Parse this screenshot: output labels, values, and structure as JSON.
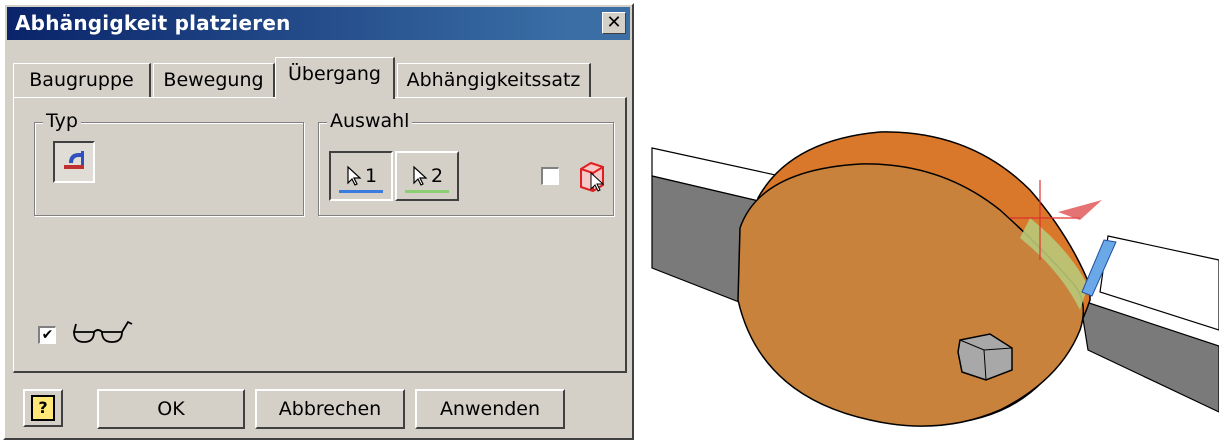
{
  "dialog": {
    "title": "Abhängigkeit platzieren",
    "close_glyph": "✕",
    "tabs": [
      {
        "label": "Baugruppe",
        "active": false
      },
      {
        "label": "Bewegung",
        "active": false
      },
      {
        "label": "Übergang",
        "active": true
      },
      {
        "label": "Abhängigkeitssatz",
        "active": false
      }
    ],
    "typ_group": {
      "label": "Typ",
      "icon": "transition-constraint-icon"
    },
    "auswahl_group": {
      "label": "Auswahl",
      "select1": {
        "number": "1",
        "icon": "cursor-arrow-icon",
        "underline_color": "#3a7be0"
      },
      "select2": {
        "number": "2",
        "icon": "cursor-arrow-icon",
        "underline_color": "#8ccf73"
      },
      "pick_part_first_checked": false,
      "pick_part_icon": "pick-part-first-icon"
    },
    "preview_checked": true,
    "preview_icon": "glasses-icon",
    "help_glyph": "?",
    "ok_label": "OK",
    "cancel_label": "Abbrechen",
    "apply_label": "Anwenden"
  },
  "viewport": {
    "description_icon": "3d-model-viewport",
    "colors": {
      "cam": "#d9782a",
      "cam_face": "#c8823c",
      "bar": "#7a7a7a",
      "highlight": "#6aa8e8",
      "constraint_glyph": "#e03030"
    }
  }
}
